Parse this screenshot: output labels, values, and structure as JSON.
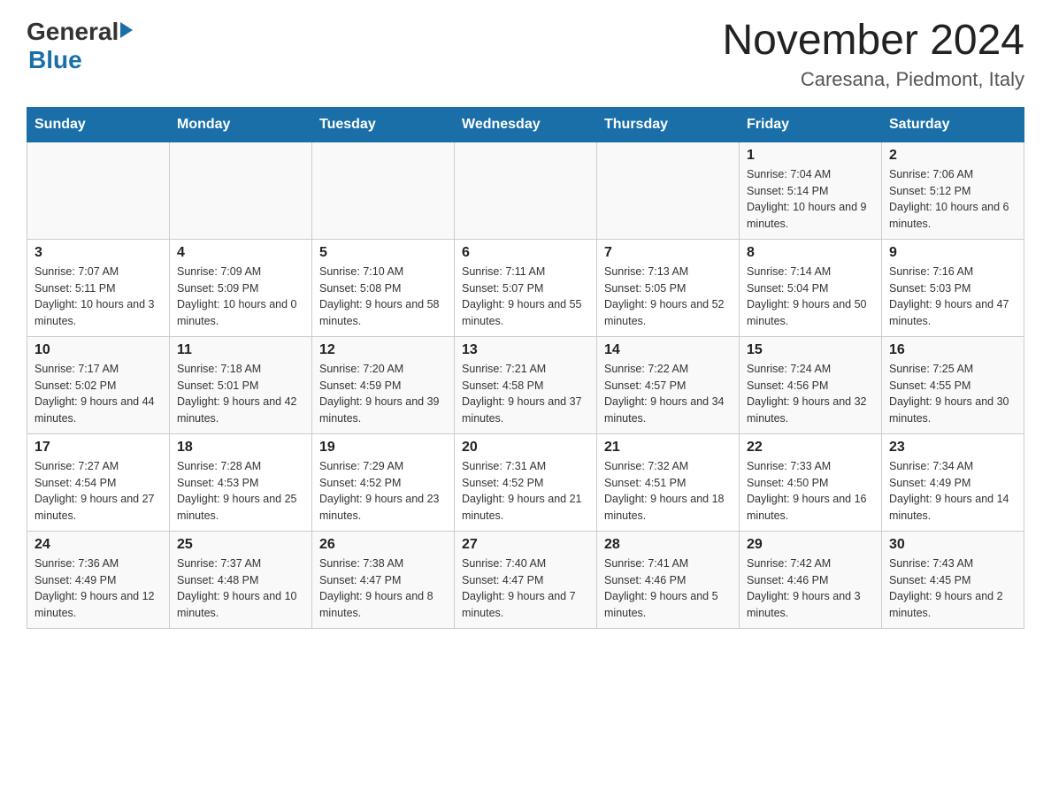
{
  "header": {
    "logo_general": "General",
    "logo_blue": "Blue",
    "month_year": "November 2024",
    "location": "Caresana, Piedmont, Italy"
  },
  "days_of_week": [
    "Sunday",
    "Monday",
    "Tuesday",
    "Wednesday",
    "Thursday",
    "Friday",
    "Saturday"
  ],
  "weeks": [
    [
      {
        "day": "",
        "sunrise": "",
        "sunset": "",
        "daylight": ""
      },
      {
        "day": "",
        "sunrise": "",
        "sunset": "",
        "daylight": ""
      },
      {
        "day": "",
        "sunrise": "",
        "sunset": "",
        "daylight": ""
      },
      {
        "day": "",
        "sunrise": "",
        "sunset": "",
        "daylight": ""
      },
      {
        "day": "",
        "sunrise": "",
        "sunset": "",
        "daylight": ""
      },
      {
        "day": "1",
        "sunrise": "Sunrise: 7:04 AM",
        "sunset": "Sunset: 5:14 PM",
        "daylight": "Daylight: 10 hours and 9 minutes."
      },
      {
        "day": "2",
        "sunrise": "Sunrise: 7:06 AM",
        "sunset": "Sunset: 5:12 PM",
        "daylight": "Daylight: 10 hours and 6 minutes."
      }
    ],
    [
      {
        "day": "3",
        "sunrise": "Sunrise: 7:07 AM",
        "sunset": "Sunset: 5:11 PM",
        "daylight": "Daylight: 10 hours and 3 minutes."
      },
      {
        "day": "4",
        "sunrise": "Sunrise: 7:09 AM",
        "sunset": "Sunset: 5:09 PM",
        "daylight": "Daylight: 10 hours and 0 minutes."
      },
      {
        "day": "5",
        "sunrise": "Sunrise: 7:10 AM",
        "sunset": "Sunset: 5:08 PM",
        "daylight": "Daylight: 9 hours and 58 minutes."
      },
      {
        "day": "6",
        "sunrise": "Sunrise: 7:11 AM",
        "sunset": "Sunset: 5:07 PM",
        "daylight": "Daylight: 9 hours and 55 minutes."
      },
      {
        "day": "7",
        "sunrise": "Sunrise: 7:13 AM",
        "sunset": "Sunset: 5:05 PM",
        "daylight": "Daylight: 9 hours and 52 minutes."
      },
      {
        "day": "8",
        "sunrise": "Sunrise: 7:14 AM",
        "sunset": "Sunset: 5:04 PM",
        "daylight": "Daylight: 9 hours and 50 minutes."
      },
      {
        "day": "9",
        "sunrise": "Sunrise: 7:16 AM",
        "sunset": "Sunset: 5:03 PM",
        "daylight": "Daylight: 9 hours and 47 minutes."
      }
    ],
    [
      {
        "day": "10",
        "sunrise": "Sunrise: 7:17 AM",
        "sunset": "Sunset: 5:02 PM",
        "daylight": "Daylight: 9 hours and 44 minutes."
      },
      {
        "day": "11",
        "sunrise": "Sunrise: 7:18 AM",
        "sunset": "Sunset: 5:01 PM",
        "daylight": "Daylight: 9 hours and 42 minutes."
      },
      {
        "day": "12",
        "sunrise": "Sunrise: 7:20 AM",
        "sunset": "Sunset: 4:59 PM",
        "daylight": "Daylight: 9 hours and 39 minutes."
      },
      {
        "day": "13",
        "sunrise": "Sunrise: 7:21 AM",
        "sunset": "Sunset: 4:58 PM",
        "daylight": "Daylight: 9 hours and 37 minutes."
      },
      {
        "day": "14",
        "sunrise": "Sunrise: 7:22 AM",
        "sunset": "Sunset: 4:57 PM",
        "daylight": "Daylight: 9 hours and 34 minutes."
      },
      {
        "day": "15",
        "sunrise": "Sunrise: 7:24 AM",
        "sunset": "Sunset: 4:56 PM",
        "daylight": "Daylight: 9 hours and 32 minutes."
      },
      {
        "day": "16",
        "sunrise": "Sunrise: 7:25 AM",
        "sunset": "Sunset: 4:55 PM",
        "daylight": "Daylight: 9 hours and 30 minutes."
      }
    ],
    [
      {
        "day": "17",
        "sunrise": "Sunrise: 7:27 AM",
        "sunset": "Sunset: 4:54 PM",
        "daylight": "Daylight: 9 hours and 27 minutes."
      },
      {
        "day": "18",
        "sunrise": "Sunrise: 7:28 AM",
        "sunset": "Sunset: 4:53 PM",
        "daylight": "Daylight: 9 hours and 25 minutes."
      },
      {
        "day": "19",
        "sunrise": "Sunrise: 7:29 AM",
        "sunset": "Sunset: 4:52 PM",
        "daylight": "Daylight: 9 hours and 23 minutes."
      },
      {
        "day": "20",
        "sunrise": "Sunrise: 7:31 AM",
        "sunset": "Sunset: 4:52 PM",
        "daylight": "Daylight: 9 hours and 21 minutes."
      },
      {
        "day": "21",
        "sunrise": "Sunrise: 7:32 AM",
        "sunset": "Sunset: 4:51 PM",
        "daylight": "Daylight: 9 hours and 18 minutes."
      },
      {
        "day": "22",
        "sunrise": "Sunrise: 7:33 AM",
        "sunset": "Sunset: 4:50 PM",
        "daylight": "Daylight: 9 hours and 16 minutes."
      },
      {
        "day": "23",
        "sunrise": "Sunrise: 7:34 AM",
        "sunset": "Sunset: 4:49 PM",
        "daylight": "Daylight: 9 hours and 14 minutes."
      }
    ],
    [
      {
        "day": "24",
        "sunrise": "Sunrise: 7:36 AM",
        "sunset": "Sunset: 4:49 PM",
        "daylight": "Daylight: 9 hours and 12 minutes."
      },
      {
        "day": "25",
        "sunrise": "Sunrise: 7:37 AM",
        "sunset": "Sunset: 4:48 PM",
        "daylight": "Daylight: 9 hours and 10 minutes."
      },
      {
        "day": "26",
        "sunrise": "Sunrise: 7:38 AM",
        "sunset": "Sunset: 4:47 PM",
        "daylight": "Daylight: 9 hours and 8 minutes."
      },
      {
        "day": "27",
        "sunrise": "Sunrise: 7:40 AM",
        "sunset": "Sunset: 4:47 PM",
        "daylight": "Daylight: 9 hours and 7 minutes."
      },
      {
        "day": "28",
        "sunrise": "Sunrise: 7:41 AM",
        "sunset": "Sunset: 4:46 PM",
        "daylight": "Daylight: 9 hours and 5 minutes."
      },
      {
        "day": "29",
        "sunrise": "Sunrise: 7:42 AM",
        "sunset": "Sunset: 4:46 PM",
        "daylight": "Daylight: 9 hours and 3 minutes."
      },
      {
        "day": "30",
        "sunrise": "Sunrise: 7:43 AM",
        "sunset": "Sunset: 4:45 PM",
        "daylight": "Daylight: 9 hours and 2 minutes."
      }
    ]
  ]
}
